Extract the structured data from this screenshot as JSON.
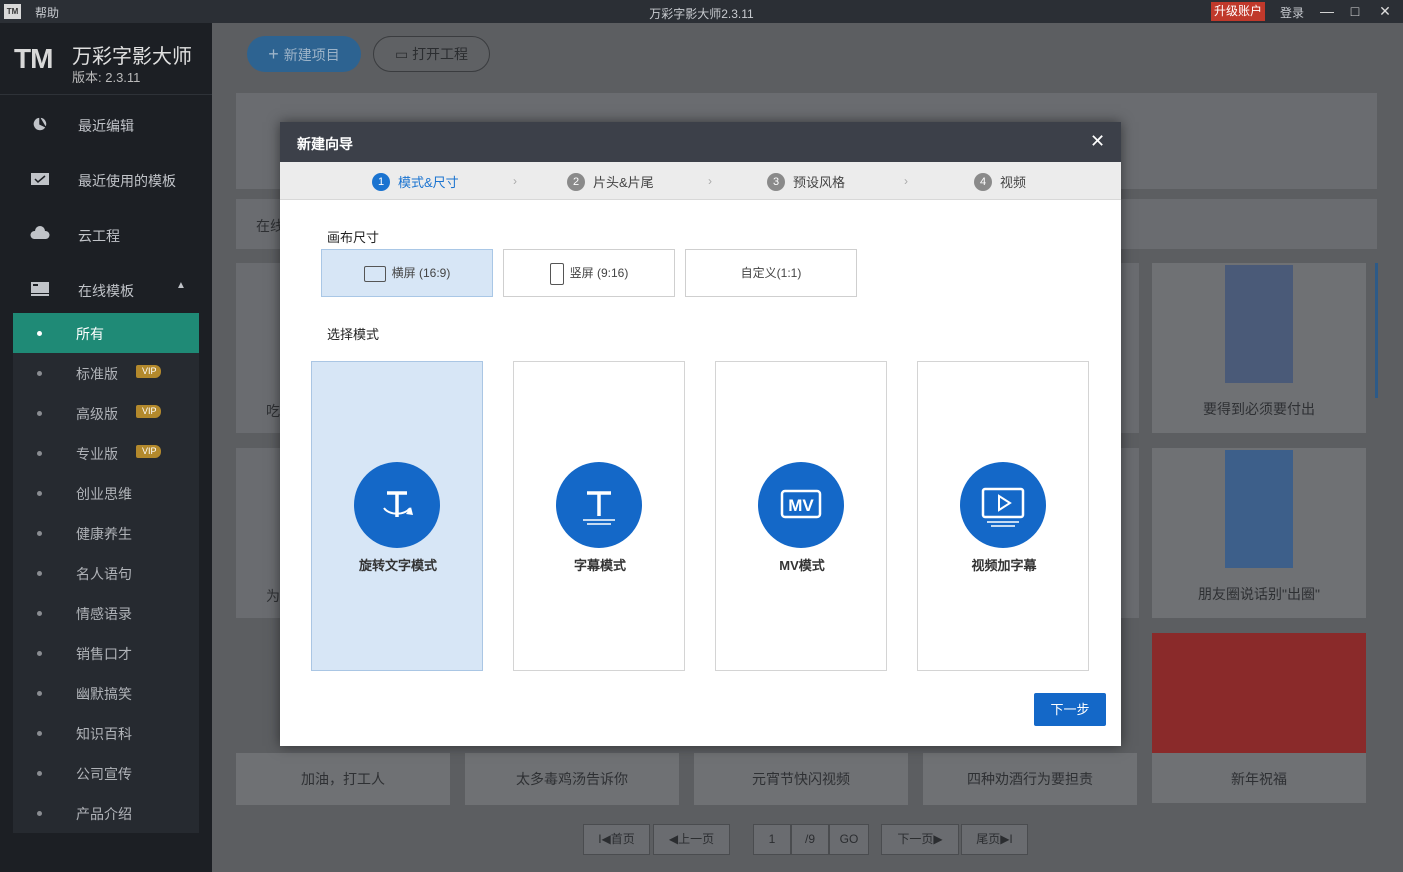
{
  "titlebar": {
    "logo": "TM",
    "help": "帮助",
    "title": "万彩字影大师2.3.11",
    "upgrade": "升级账户",
    "login": "登录",
    "minimize": "—",
    "maximize": "□",
    "close": "✕"
  },
  "brand": {
    "logo": "TM",
    "name": "万彩字影大师",
    "version": "版本: 2.3.11"
  },
  "nav": {
    "recent_edit": "最近编辑",
    "recent_templates": "最近使用的模板",
    "cloud": "云工程",
    "online_templates": "在线模板"
  },
  "subnav": [
    {
      "label": "所有",
      "vip": ""
    },
    {
      "label": "标准版",
      "vip": "VIP"
    },
    {
      "label": "高级版",
      "vip": "VIP"
    },
    {
      "label": "专业版",
      "vip": "VIP"
    },
    {
      "label": "创业思维",
      "vip": ""
    },
    {
      "label": "健康养生",
      "vip": ""
    },
    {
      "label": "名人语句",
      "vip": ""
    },
    {
      "label": "情感语录",
      "vip": ""
    },
    {
      "label": "销售口才",
      "vip": ""
    },
    {
      "label": "幽默搞笑",
      "vip": ""
    },
    {
      "label": "知识百科",
      "vip": ""
    },
    {
      "label": "公司宣传",
      "vip": ""
    },
    {
      "label": "产品介绍",
      "vip": ""
    }
  ],
  "main": {
    "new_project": "新建项目",
    "open_project": "打开工程",
    "online_label": "在线",
    "partial_left_1": "吃",
    "partial_left_2": "为",
    "cards": {
      "card1": "要得到必须要付出",
      "card2": "朋友圈说话别\"出圈\"",
      "card3": "新年祝福"
    },
    "bottom_cards": [
      "加油，打工人",
      "太多毒鸡汤告诉你",
      "元宵节快闪视频",
      "四种劝酒行为要担责"
    ],
    "pager": {
      "first": "I◀首页",
      "prev": "◀上一页",
      "current": "1",
      "total": "/9",
      "go": "GO",
      "next": "下一页▶",
      "last": "尾页▶I"
    }
  },
  "modal": {
    "title": "新建向导",
    "close": "✕",
    "steps": [
      {
        "num": "1",
        "label": "模式&尺寸"
      },
      {
        "num": "2",
        "label": "片头&片尾"
      },
      {
        "num": "3",
        "label": "预设风格"
      },
      {
        "num": "4",
        "label": "视频"
      }
    ],
    "canvas_size_label": "画布尺寸",
    "sizes": [
      "横屏 (16:9)",
      "竖屏 (9:16)",
      "自定义(1:1)"
    ],
    "mode_label": "选择模式",
    "modes": [
      "旋转文字模式",
      "字幕模式",
      "MV模式",
      "视频加字幕"
    ],
    "mv_icon_text": "MV",
    "next_button": "下一步"
  },
  "colors": {
    "accent": "#1468c8",
    "active_nav": "#1f8a76",
    "vip": "#b3892c",
    "upgrade": "#c0392b"
  }
}
